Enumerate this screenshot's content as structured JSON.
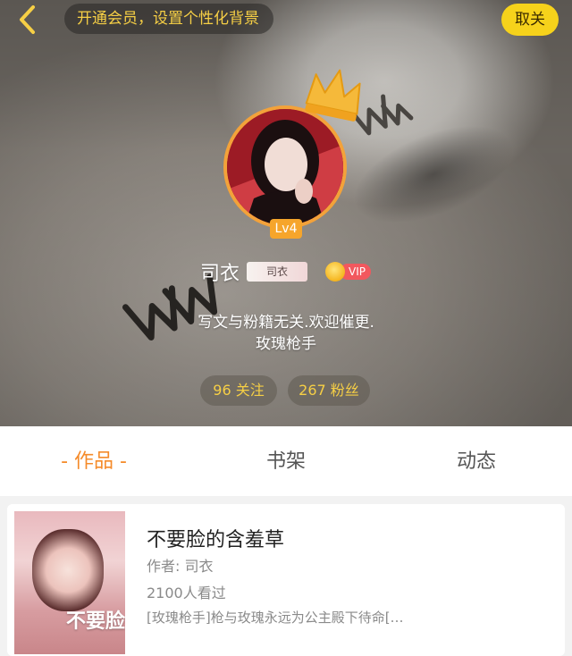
{
  "header": {
    "vip_banner": "开通会员，设置个性化背景",
    "unfollow_label": "取关"
  },
  "profile": {
    "level": "Lv4",
    "username": "司衣",
    "name_tag": "司衣",
    "vip_label": "VIP",
    "bio_line1": "写文与粉籍无关.欢迎催更.",
    "bio_line2": "玫瑰枪手",
    "following": "96 关注",
    "followers": "267 粉丝"
  },
  "tabs": {
    "works": "- 作品 -",
    "shelf": "书架",
    "activity": "动态"
  },
  "book": {
    "cover_text": "不要脸",
    "title": "不要脸的含羞草",
    "author": "作者: 司衣",
    "views": "2100人看过",
    "description": "[玫瑰枪手]枪与玫瑰永远为公主殿下待命[…"
  },
  "colors": {
    "accent": "#f58b2a",
    "yellow": "#f6d21b",
    "gold_text": "#f6cf45"
  },
  "icons": {
    "back": "chevron-left-icon",
    "crown": "crown-icon",
    "vip_coin": "coin-icon"
  }
}
